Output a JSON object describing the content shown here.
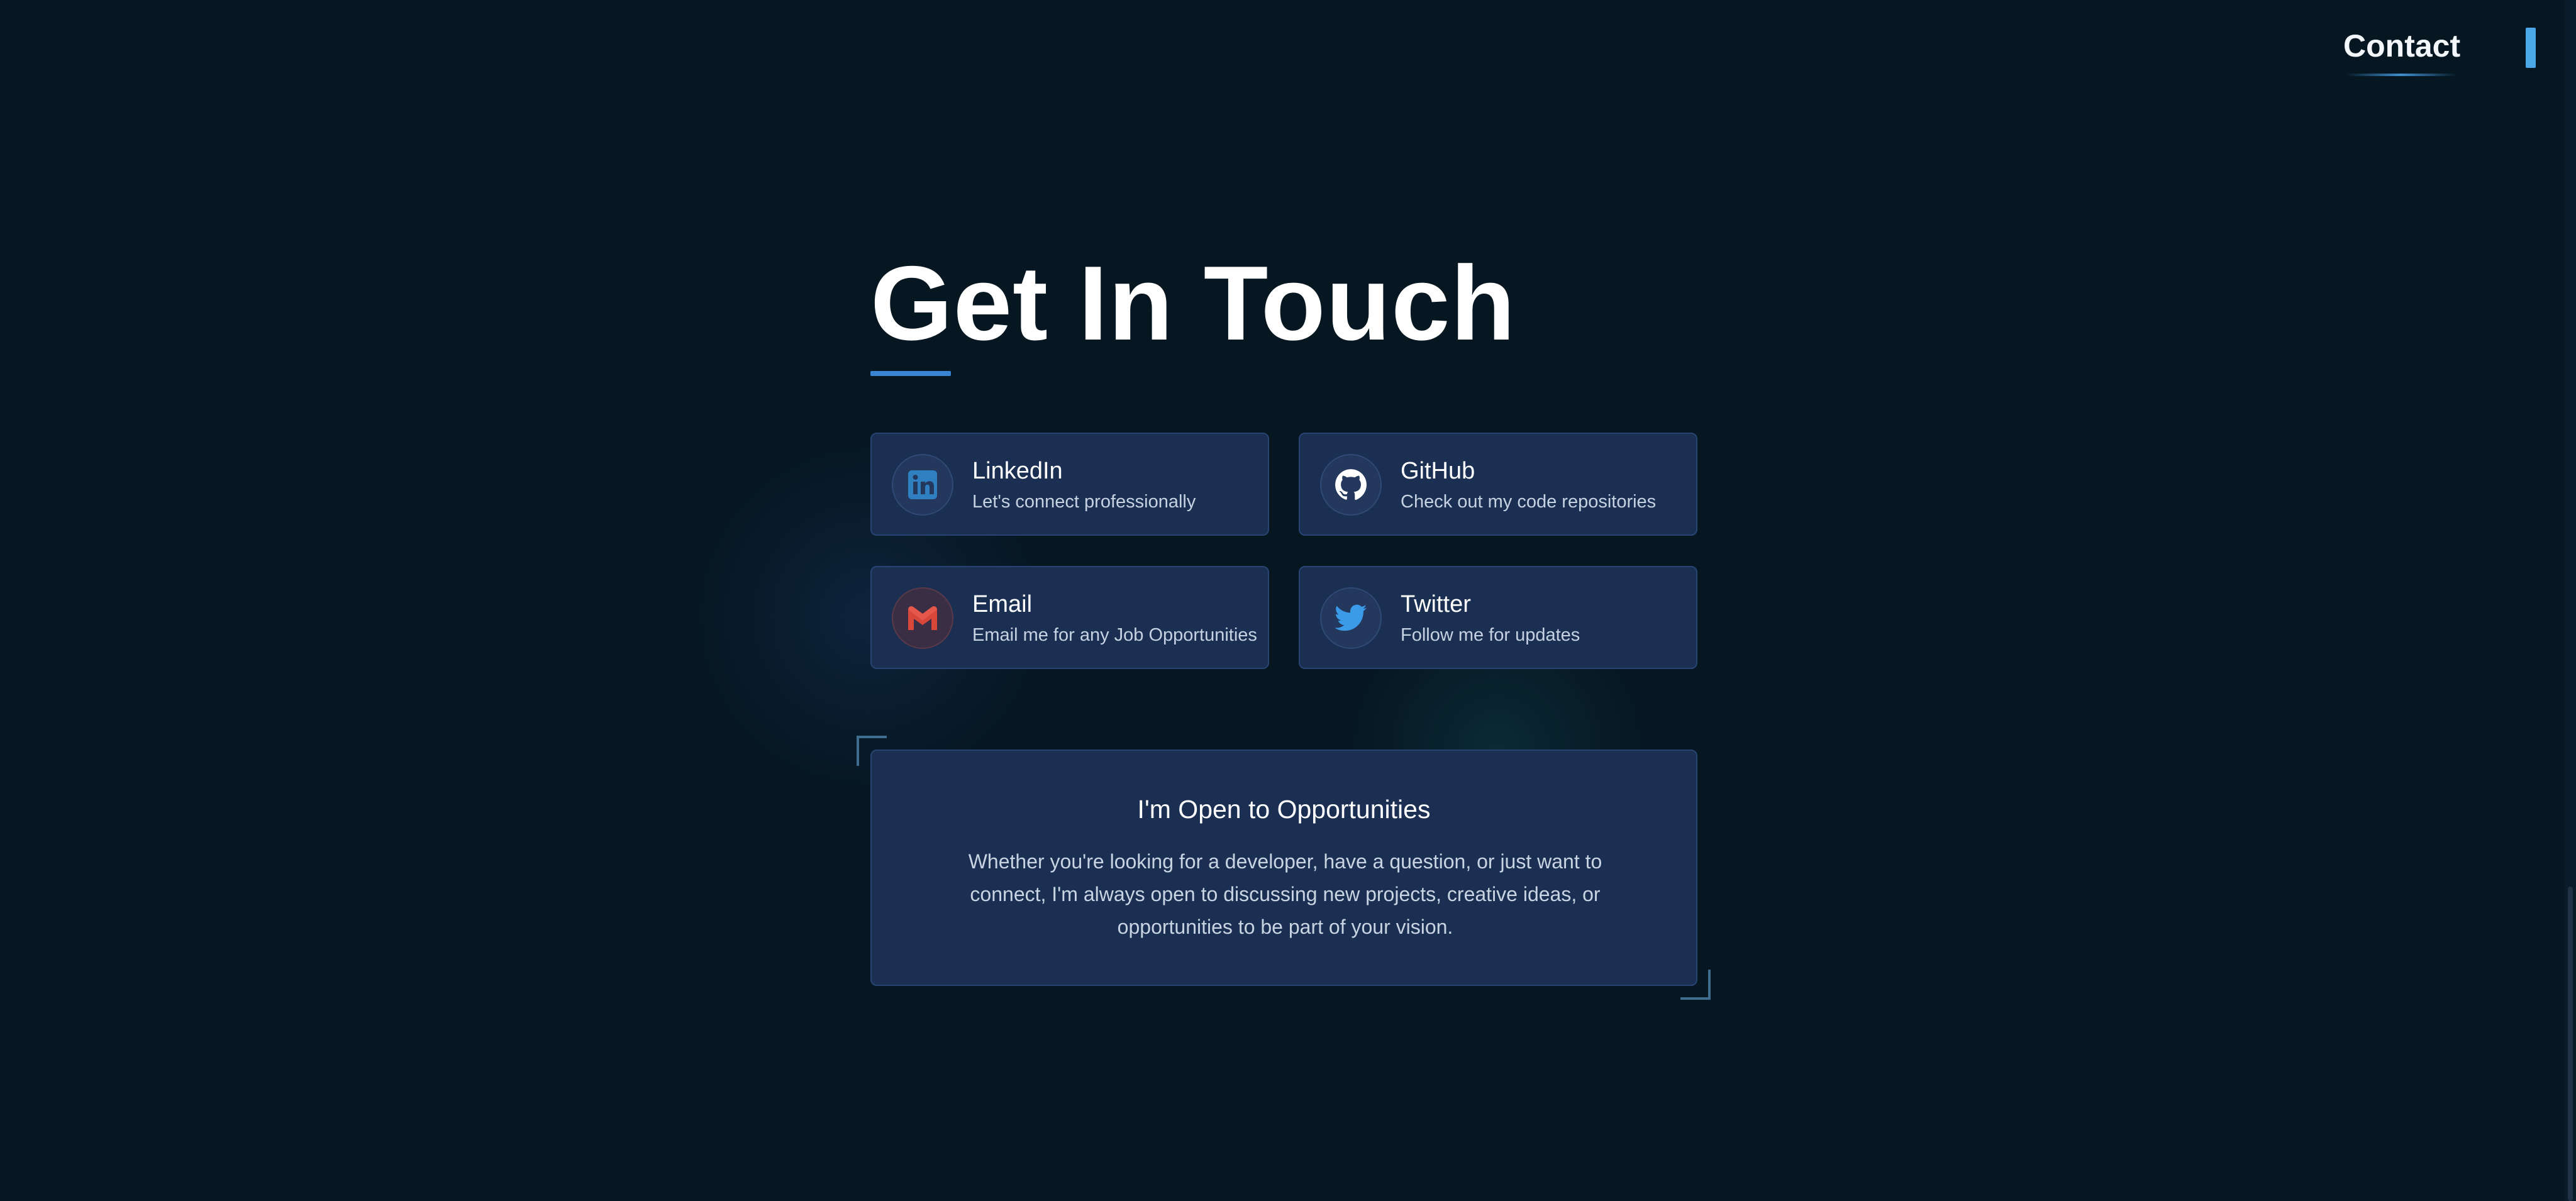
{
  "nav": {
    "active_link": "Contact"
  },
  "page": {
    "title": "Get In Touch"
  },
  "contacts": [
    {
      "label": "LinkedIn",
      "description": "Let's connect professionally",
      "icon": "linkedin-icon",
      "color": "#2f7fc1"
    },
    {
      "label": "GitHub",
      "description": "Check out my code repositories",
      "icon": "github-icon",
      "color": "#ffffff"
    },
    {
      "label": "Email",
      "description": "Email me for any Job Opportunities",
      "icon": "gmail-icon",
      "color": "#d9463a"
    },
    {
      "label": "Twitter",
      "description": "Follow me for updates",
      "icon": "twitter-icon",
      "color": "#3b9be8"
    }
  ],
  "opportunities": {
    "title": "I'm Open to Opportunities",
    "body": "Whether you're looking for a developer, have a question, or just want to connect, I'm always open to discussing new projects, creative ideas, or opportunities to be part of your vision."
  },
  "colors": {
    "background": "#061722",
    "card": "#1a2f52",
    "accent": "#3b84d4"
  }
}
